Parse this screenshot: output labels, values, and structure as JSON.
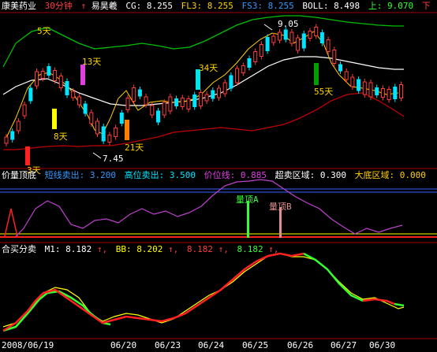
{
  "colors": {
    "bg": "#000000",
    "up": "#ff3d3d",
    "down": "#00e5ff",
    "boll_mid": "#ffffff",
    "boll_up": "#00c000",
    "boll_dn": "#c00000",
    "ma_yellow": "#ffd000",
    "magenta": "#e040e0",
    "green_signal": "#33ff33",
    "blue_line": "#3366ff"
  },
  "header": {
    "name": "康美药业",
    "period": "30分钟",
    "indicator": "易昊羲",
    "cg": "CG: 8.255",
    "fl3": "FL3: 8.255",
    "fs3": "FS3: 8.255",
    "boll": "BOLL: 8.498",
    "up": "上: 9.070",
    "down": "下"
  },
  "price_annotations": {
    "high": "9.05",
    "low": "7.45",
    "day_labels": [
      "5天",
      "13天",
      "8天",
      "21天",
      "34天",
      "55天",
      "3天"
    ]
  },
  "vol_panel": {
    "title": "价量顶底",
    "short_sell": "短线卖出: 3.200",
    "high_sell": "高位卖出: 3.500",
    "price_line": "价位线: 0.885",
    "oversold": "超卖区域: 0.300",
    "bottom_zone": "大底区域: 0.000",
    "label_a": "量顶A",
    "label_b": "量顶B"
  },
  "bs_panel": {
    "title": "合买分卖",
    "m1": "M1: 8.182",
    "bb": "BB: 8.202",
    "v3": "8.182",
    "v4": "8.182"
  },
  "dates": [
    "2008/06/19",
    "06/20",
    "06/23",
    "06/24",
    "06/25",
    "06/26",
    "06/27",
    "06/30"
  ]
}
